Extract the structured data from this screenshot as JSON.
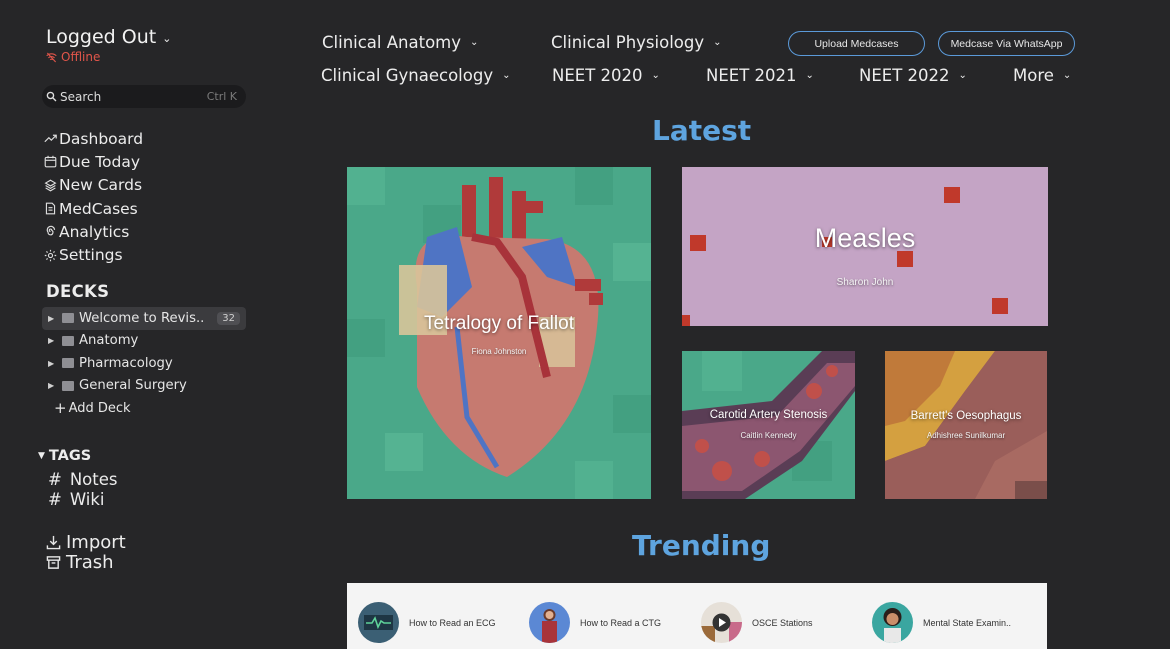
{
  "account": {
    "name": "Logged Out",
    "status": "Offline"
  },
  "search": {
    "label": "Search",
    "shortcut": "Ctrl K"
  },
  "nav": [
    {
      "label": "Dashboard",
      "icon": "trend-icon"
    },
    {
      "label": "Due Today",
      "icon": "calendar-icon"
    },
    {
      "label": "New Cards",
      "icon": "layers-icon"
    },
    {
      "label": "MedCases",
      "icon": "document-icon"
    },
    {
      "label": "Analytics",
      "icon": "spiral-icon"
    },
    {
      "label": "Settings",
      "icon": "gear-icon"
    }
  ],
  "decks": {
    "heading": "DECKS",
    "items": [
      {
        "label": "Welcome to Revis..",
        "count": "32"
      },
      {
        "label": "Anatomy"
      },
      {
        "label": "Pharmacology"
      },
      {
        "label": "General Surgery"
      }
    ],
    "add_label": "Add Deck"
  },
  "tags": {
    "heading": "TAGS",
    "items": [
      "Notes",
      "Wiki"
    ]
  },
  "utilities": [
    {
      "label": "Import",
      "icon": "download-icon"
    },
    {
      "label": "Trash",
      "icon": "trash-icon"
    }
  ],
  "top_menu": {
    "items": [
      "Clinical Anatomy",
      "Clinical Physiology",
      "Clinical Gynaecology",
      "NEET 2020",
      "NEET 2021",
      "NEET 2022",
      "More"
    ],
    "buttons": [
      "Upload Medcases",
      "Medcase Via WhatsApp"
    ]
  },
  "latest": {
    "heading": "Latest",
    "cards": [
      {
        "title": "Tetralogy of Fallot",
        "author": "Fiona Johnston"
      },
      {
        "title": "Measles",
        "author": "Sharon John"
      },
      {
        "title": "Carotid Artery Stenosis",
        "author": "Caitlin Kennedy"
      },
      {
        "title": "Barrett's Oesophagus",
        "author": "Adhishree Sunilkumar"
      }
    ]
  },
  "trending": {
    "heading": "Trending",
    "items": [
      "How to Read an ECG",
      "How to Read a CTG",
      "OSCE Stations",
      "Mental State Examin.."
    ]
  },
  "colors": {
    "background": "#262628",
    "accent": "#5ea4df",
    "offline": "#e0554a",
    "pill_border": "#5b9ad9"
  }
}
